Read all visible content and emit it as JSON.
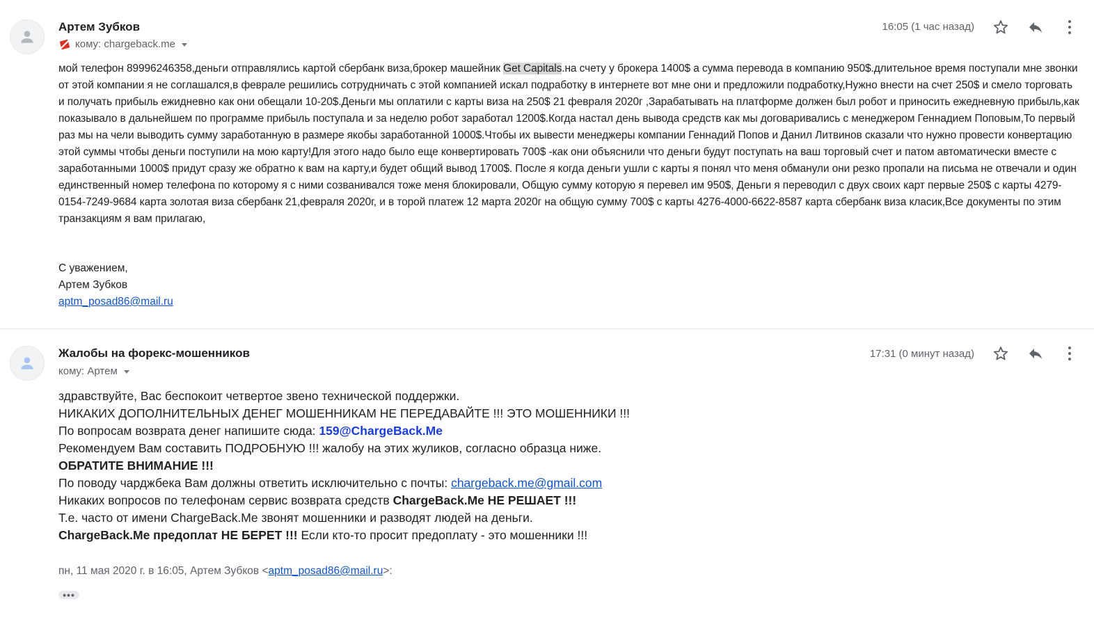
{
  "messages": [
    {
      "sender": "Артем Зубков",
      "recipient": "кому: chargeback.me",
      "timestamp": "16:05 (1 час назад)",
      "body_before_highlight": "мой телефон 89996246358,деньги отправлялись картой сбербанк виза,брокер машейник ",
      "body_highlight": "Get Capitals",
      "body_after_highlight": ".на счету у брокера 1400$ а сумма перевода в компанию 950$.длительное время поступали мне звонки от этой компании я не соглашался,в феврале решились сотрудничать с этой компанией искал подработку в интернете вот мне они и предложили подработку,Нужно внести на счет 250$ и смело торговать и получать прибыль ежидневно как они обещали 10-20$.Деньги мы оплатили с карты виза на 250$ 21 февраля 2020г ,Зарабатывать на платформе должен был робот и приносить ежедневную прибыль,как показывало в дальнейшем по программе прибыль поступала и за неделю робот заработал 1200$.Когда настал день вывода средств как мы договаривались с менеджером Геннадием Поповым,То первый раз мы на чели выводить сумму заработанную в размере якобы заработанной 1000$.Чтобы их вывести менеджеры компании Геннадий Попов и Данил Литвинов сказали что нужно провести конвертацию этой суммы чтобы деньги поступили на мою карту!Для этого надо было еще конвертировать 700$ -как они объяснили что деньги будут поступать на ваш торговый счет и патом автоматически вместе с заработанными 1000$ придут сразу же обратно к вам на карту,и будет общий вывод 1700$. После я когда деньги ушли с карты я понял что меня обманули они резко пропали на письма не отвечали и один единственный номер телефона по которому я с ними созванивался тоже меня блокировали, Общую сумму которую я перевел им 950$, Деньги я переводил с двух своих карт первые 250$ с карты 4279-0154-7249-9684 карта золотая виза сбербанк 21,февраля 2020г, и в торой платеж 12 марта 2020г на общую сумму 700$ с карты 4276-4000-6622-8587 карта сбербанк виза класик,Все документы по этим транзакциям я вам прилагаю,",
      "signature_line1": "С уважением,",
      "signature_line2": "Артем Зубков",
      "signature_email": "aptm_posad86@mail.ru"
    },
    {
      "sender": "Жалобы на форекс-мошенников",
      "recipient": "кому: Артем",
      "timestamp": "17:31 (0 минут назад)",
      "line1": "здравствуйте, Вас беспокоит четвертое звено технической поддержки.",
      "line2": "НИКАКИХ ДОПОЛНИТЕЛЬНЫХ ДЕНЕГ МОШЕННИКАМ НЕ ПЕРЕДАВАЙТЕ !!! ЭТО МОШЕННИКИ !!!",
      "line3_prefix": "По вопросам возврата денег напишите сюда: ",
      "line3_email": "159@ChargeBack.Me",
      "line4": "Рекомендуем Вам составить ПОДРОБНУЮ !!! жалобу на этих жуликов, согласно образца ниже.",
      "line5": "ОБРАТИТЕ ВНИМАНИЕ !!!",
      "line6_prefix": "По поводу чарджбека Вам должны ответить исключительно с почты: ",
      "line6_email": "chargeback.me@gmail.com",
      "line7_prefix": "Никаких вопросов по телефонам сервис возврата средств ",
      "line7_bold": "ChargeBack.Me НЕ РЕШАЕТ !!!",
      "line8": "Т.е. часто от имени ChargeBack.Me звонят мошенники и разводят людей на деньги.",
      "line9_bold": "ChargeBack.Me предоплат НЕ БЕРЕТ !!!",
      "line9_suffix": " Если кто-то просит предоплату - это мошенники !!!",
      "quote_prefix": "пн, 11 мая 2020 г. в 16:05, Артем Зубков <",
      "quote_email": "aptm_posad86@mail.ru",
      "quote_suffix": ">:",
      "ellipsis": "•••"
    }
  ],
  "icons": {
    "avatar": "person-icon",
    "star": "star-icon",
    "reply": "reply-icon",
    "more": "more-vert-icon",
    "unsafe": "unsafe-sender-icon"
  }
}
